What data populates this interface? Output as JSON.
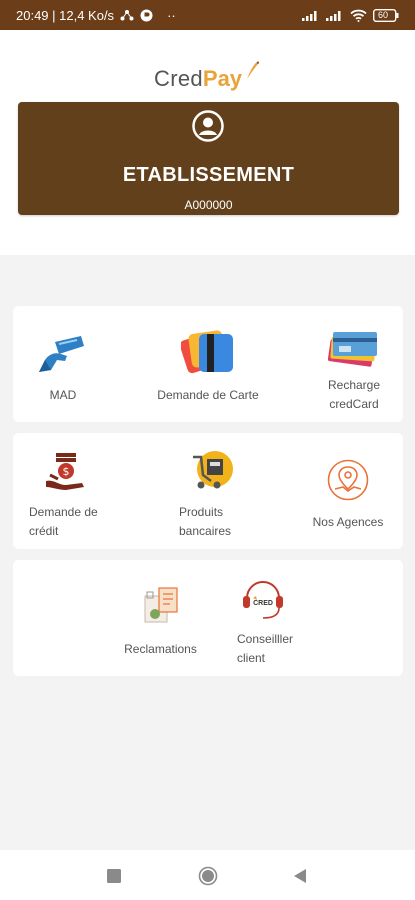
{
  "status_bar": {
    "time_speed": "20:49 | 12,4 Ko/s",
    "dots": "··",
    "battery": "60"
  },
  "logo": {
    "part1": "Cred",
    "part2": "Pay"
  },
  "account_card": {
    "title": "ETABLISSEMENT",
    "code": "A000000"
  },
  "menu": {
    "mad": "MAD",
    "demande_carte": "Demande de Carte",
    "recharge_line1": "Recharge",
    "recharge_line2": "credCard",
    "demande_credit_line1": "Demande de",
    "demande_credit_line2": "crédit",
    "produits_line1": "Produits",
    "produits_line2": "bancaires",
    "agences": "Nos Agences",
    "reclamations": "Reclamations",
    "conseiller_line1": "Conseilller",
    "conseiller_line2": "client",
    "logo_badge_text": "CRED"
  },
  "colors": {
    "brand_brown": "#63401c",
    "status_brown": "#6b3d18",
    "accent_orange": "#e8a33b"
  }
}
